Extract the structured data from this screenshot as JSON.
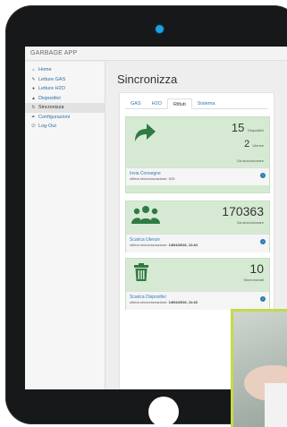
{
  "app": {
    "title": "GARBAGE APP"
  },
  "sidebar": {
    "items": [
      {
        "label": "Home",
        "icon": "home-icon"
      },
      {
        "label": "Letture GAS",
        "icon": "gas-icon"
      },
      {
        "label": "Letture H2O",
        "icon": "water-drop-icon"
      },
      {
        "label": "Dispositivi",
        "icon": "device-icon"
      },
      {
        "label": "Sincronizza",
        "icon": "sync-icon",
        "active": true
      },
      {
        "label": "Configurazioni",
        "icon": "wrench-icon"
      },
      {
        "label": "Log-Out",
        "icon": "power-icon"
      }
    ]
  },
  "main": {
    "title": "Sincronizza",
    "tabs": [
      {
        "label": "GAS"
      },
      {
        "label": "H2O"
      },
      {
        "label": "Rifiuti",
        "active": true
      },
      {
        "label": "Sistema"
      }
    ],
    "cards": {
      "send": {
        "icon": "share-arrow-icon",
        "devices_value": "15",
        "devices_label": "Dispositivi",
        "users_value": "2",
        "users_label": "Utenze",
        "pending_label": "Da sincronizzare",
        "footer_link": "Invia Consegne",
        "footer_sub": "ultima sincronizzazione: N/D"
      },
      "users": {
        "icon": "users-icon",
        "value": "170363",
        "label": "Da sincronizzare",
        "footer_link": "Scarica Utenze",
        "footer_sub_label": "ultima sincronizzazione:",
        "footer_sub_value": "14/04/2016, 11:44"
      },
      "devices": {
        "icon": "trash-icon",
        "value": "10",
        "label": "Sincronizzati",
        "footer_link": "Scarica Dispositivi",
        "footer_sub_label": "ultima sincronizzazione:",
        "footer_sub_value": "14/04/2016, 11:43"
      }
    }
  },
  "colors": {
    "accent": "#2c7bb6",
    "card_bg": "#d6ead3",
    "icon_green": "#2f7a43",
    "camera": "#1aa2e0"
  }
}
